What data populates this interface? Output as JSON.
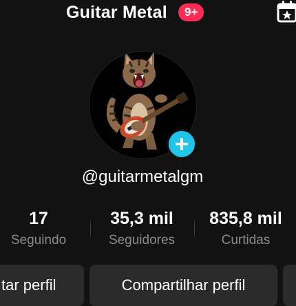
{
  "header": {
    "title": "Guitar Metal",
    "notification_badge": "9+",
    "calendar_icon": "calendar-star-icon"
  },
  "profile": {
    "avatar_icon": "cat-playing-guitar-avatar",
    "add_icon": "plus-icon",
    "username": "@guitarmetalgm"
  },
  "stats": [
    {
      "value": "17",
      "label": "Seguindo"
    },
    {
      "value": "35,3 mil",
      "label": "Seguidores"
    },
    {
      "value": "835,8 mil",
      "label": "Curtidas"
    }
  ],
  "actions": {
    "edit_label": "tar perfil",
    "share_label": "Compartilhar perfil"
  },
  "colors": {
    "background": "#121212",
    "badge": "#fe2c55",
    "add_button": "#20c5e8",
    "secondary_text": "#8a8a8a",
    "button_bg": "#2b2b2b"
  }
}
